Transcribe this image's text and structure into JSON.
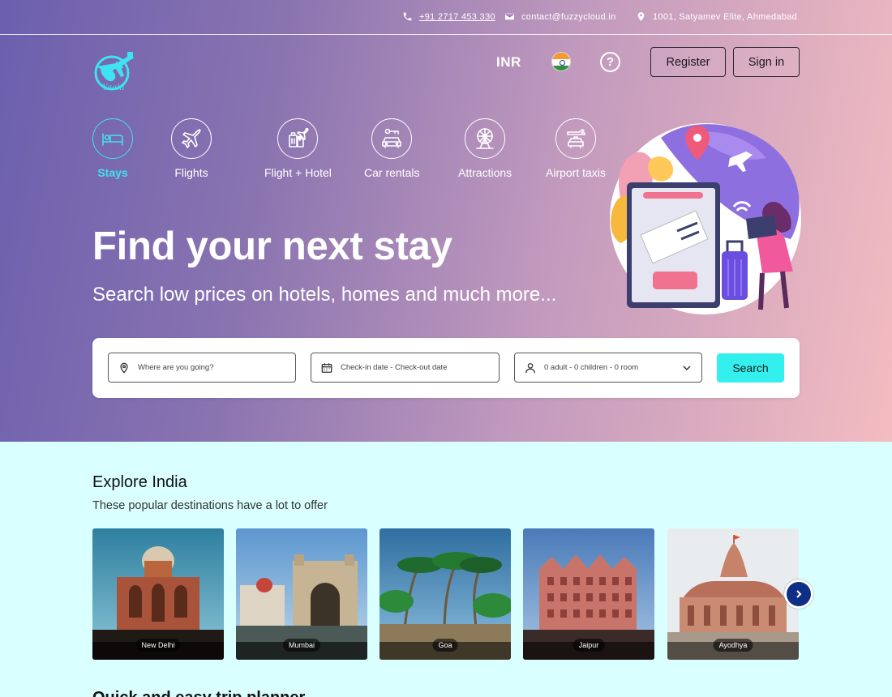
{
  "topbar": {
    "phone": "+91 2717 453 330",
    "email": "contact@fuzzycloud.in",
    "address": "1001, Satyamev Elite, Ahmedabad"
  },
  "header": {
    "logo_text": "Yaahi",
    "currency": "INR",
    "help_symbol": "?",
    "register_label": "Register",
    "signin_label": "Sign in"
  },
  "services": [
    {
      "label": "Stays",
      "active": true,
      "icon": "bed-icon"
    },
    {
      "label": "Flights",
      "active": false,
      "icon": "plane-icon"
    },
    {
      "label": "Flight + Hotel",
      "active": false,
      "icon": "luggage-plane-icon"
    },
    {
      "label": "Car rentals",
      "active": false,
      "icon": "car-key-icon"
    },
    {
      "label": "Attractions",
      "active": false,
      "icon": "ferris-wheel-icon"
    },
    {
      "label": "Airport taxis",
      "active": false,
      "icon": "taxi-plane-icon"
    }
  ],
  "hero": {
    "title": "Find your next stay",
    "subtitle": "Search low prices on hotels, homes and much more..."
  },
  "search": {
    "destination_placeholder": "Where are you going?",
    "dates_placeholder": "Check-in date - Check-out date",
    "guests_value": "0 adult - 0 children - 0 room",
    "button_label": "Search"
  },
  "explore": {
    "title": "Explore India",
    "subtitle": "These popular destinations have a lot to offer",
    "destinations": [
      "New Delhi",
      "Mumbai",
      "Goa",
      "Jaipur",
      "Ayodhya"
    ]
  },
  "next_section_title": "Quick and easy trip planner",
  "colors": {
    "accent": "#33f0ef",
    "active_service": "#3fe2f0",
    "section_bg": "#d9ffff",
    "carousel_button": "#0f2f86"
  }
}
